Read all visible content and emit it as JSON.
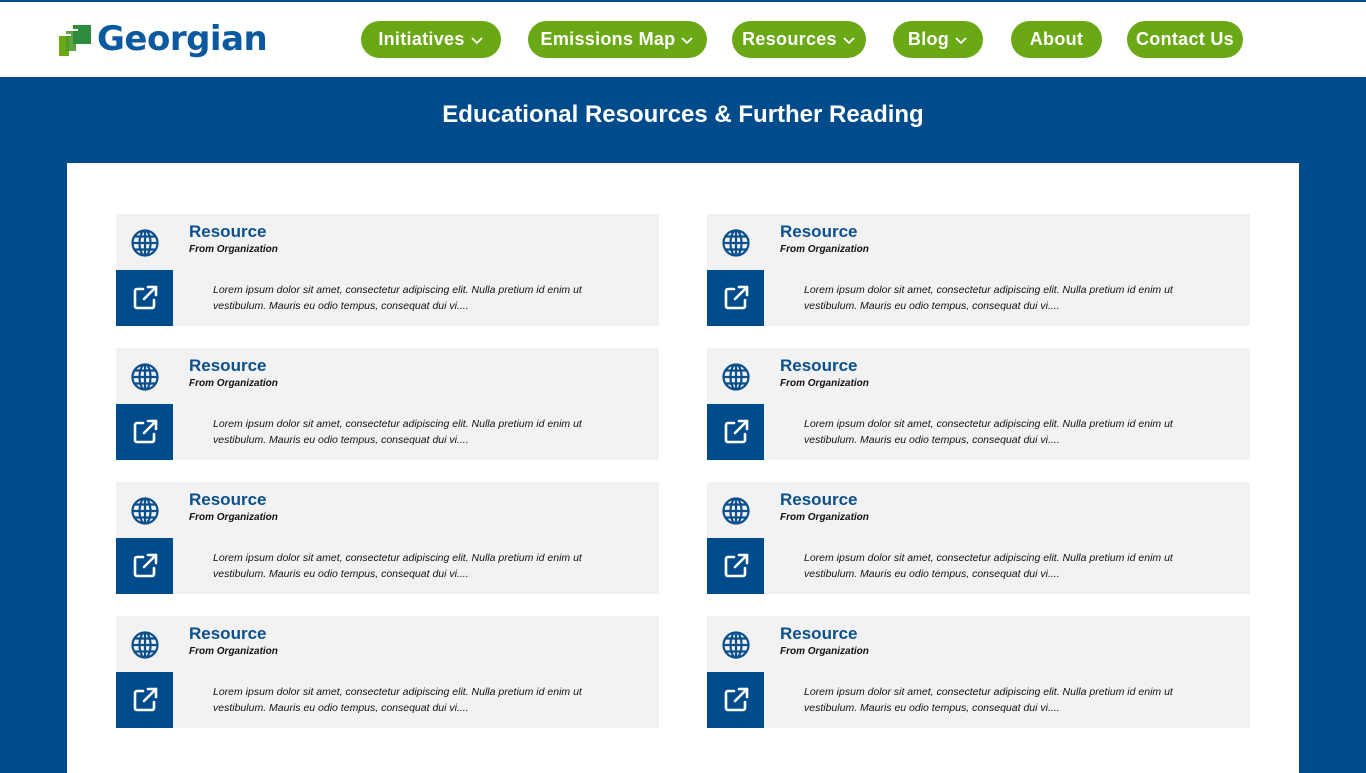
{
  "brand": {
    "name": "Georgian"
  },
  "nav": [
    {
      "label": "Initiatives",
      "dropdown": true
    },
    {
      "label": "Emissions Map",
      "dropdown": true
    },
    {
      "label": "Resources",
      "dropdown": true
    },
    {
      "label": "Blog",
      "dropdown": true
    },
    {
      "label": "About",
      "dropdown": false
    },
    {
      "label": "Contact Us",
      "dropdown": false
    }
  ],
  "page": {
    "title": "Educational Resources & Further Reading"
  },
  "resources": [
    {
      "title": "Resource",
      "organization": "From Organization",
      "description": "Lorem ipsum dolor sit amet, consectetur adipiscing elit. Nulla pretium id enim ut vestibulum. Mauris eu odio tempus, consequat dui vi...."
    },
    {
      "title": "Resource",
      "organization": "From Organization",
      "description": "Lorem ipsum dolor sit amet, consectetur adipiscing elit. Nulla pretium id enim ut vestibulum. Mauris eu odio tempus, consequat dui vi...."
    },
    {
      "title": "Resource",
      "organization": "From Organization",
      "description": "Lorem ipsum dolor sit amet, consectetur adipiscing elit. Nulla pretium id enim ut vestibulum. Mauris eu odio tempus, consequat dui vi...."
    },
    {
      "title": "Resource",
      "organization": "From Organization",
      "description": "Lorem ipsum dolor sit amet, consectetur adipiscing elit. Nulla pretium id enim ut vestibulum. Mauris eu odio tempus, consequat dui vi...."
    },
    {
      "title": "Resource",
      "organization": "From Organization",
      "description": "Lorem ipsum dolor sit amet, consectetur adipiscing elit. Nulla pretium id enim ut vestibulum. Mauris eu odio tempus, consequat dui vi...."
    },
    {
      "title": "Resource",
      "organization": "From Organization",
      "description": "Lorem ipsum dolor sit amet, consectetur adipiscing elit. Nulla pretium id enim ut vestibulum. Mauris eu odio tempus, consequat dui vi...."
    },
    {
      "title": "Resource",
      "organization": "From Organization",
      "description": "Lorem ipsum dolor sit amet, consectetur adipiscing elit. Nulla pretium id enim ut vestibulum. Mauris eu odio tempus, consequat dui vi...."
    },
    {
      "title": "Resource",
      "organization": "From Organization",
      "description": "Lorem ipsum dolor sit amet, consectetur adipiscing elit. Nulla pretium id enim ut vestibulum. Mauris eu odio tempus, consequat dui vi...."
    }
  ],
  "icons": {
    "card_top": "globe-icon",
    "card_link": "external-link-icon",
    "nav_dropdown": "chevron-down-icon"
  },
  "colors": {
    "primary_blue": "#004b8b",
    "nav_green": "#6aa815",
    "card_bg": "#f2f2f2",
    "title_blue": "#0b4f8c"
  }
}
